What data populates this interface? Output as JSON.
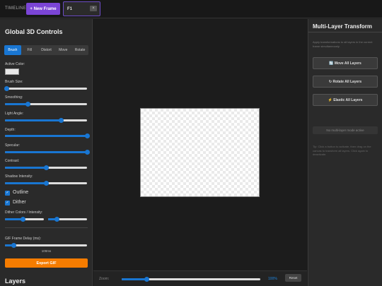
{
  "topbar": {
    "timeline_label": "TIMELINE",
    "new_frame_label": "+ New Frame",
    "frame_tab_label": "F1",
    "frame_close_label": "×"
  },
  "left": {
    "title": "Global 3D Controls",
    "tabs": [
      {
        "label": "Brush",
        "active": true
      },
      {
        "label": "Fill",
        "active": false
      },
      {
        "label": "Distort",
        "active": false
      },
      {
        "label": "Move",
        "active": false
      },
      {
        "label": "Rotate",
        "active": false
      }
    ],
    "active_color_label": "Active Color:",
    "active_color_value": "#e8e8e8",
    "sliders": [
      {
        "label": "Brush Size:",
        "value": 0.02
      },
      {
        "label": "Smoothing:",
        "value": 0.28
      },
      {
        "label": "Light Angle:",
        "value": 0.68
      },
      {
        "label": "Depth:",
        "value": 1.0
      },
      {
        "label": "Specular:",
        "value": 1.0
      },
      {
        "label": "Contrast:",
        "value": 0.5
      },
      {
        "label": "Shadow Intensity:",
        "value": 0.5
      }
    ],
    "outline_label": "Outline",
    "outline_checked": true,
    "dither_label": "Dither",
    "dither_checked": true,
    "dither_colors_label": "Dither Colors / Intensity:",
    "dither_colors_value": 0.46,
    "dither_intensity_value": 0.22,
    "gif_delay_label": "GIF Frame Delay (ms):",
    "gif_delay_value": 0.1,
    "gif_delay_display": "100ms",
    "export_label": "Export GIF",
    "layers_title": "Layers"
  },
  "center": {
    "zoom_label": "Zoom:",
    "zoom_value": 0.18,
    "zoom_display": "100%",
    "reset_label": "Reset"
  },
  "right": {
    "title": "Multi-Layer Transform",
    "description": "Apply transformations to all layers in the current frame simultaneously.",
    "buttons": [
      {
        "label": "🔄 Move All Layers"
      },
      {
        "label": "↻ Rotate All Layers"
      },
      {
        "label": "⚡ Elastic All Layers"
      }
    ],
    "status": "No multi-layer mode active",
    "tip": "Tip: Click a button to activate, then drag on the canvas to transform all layers. Click again to deactivate."
  },
  "colors": {
    "accent": "#1976d2",
    "new_frame": "#7b45d6",
    "export": "#f57c00"
  }
}
